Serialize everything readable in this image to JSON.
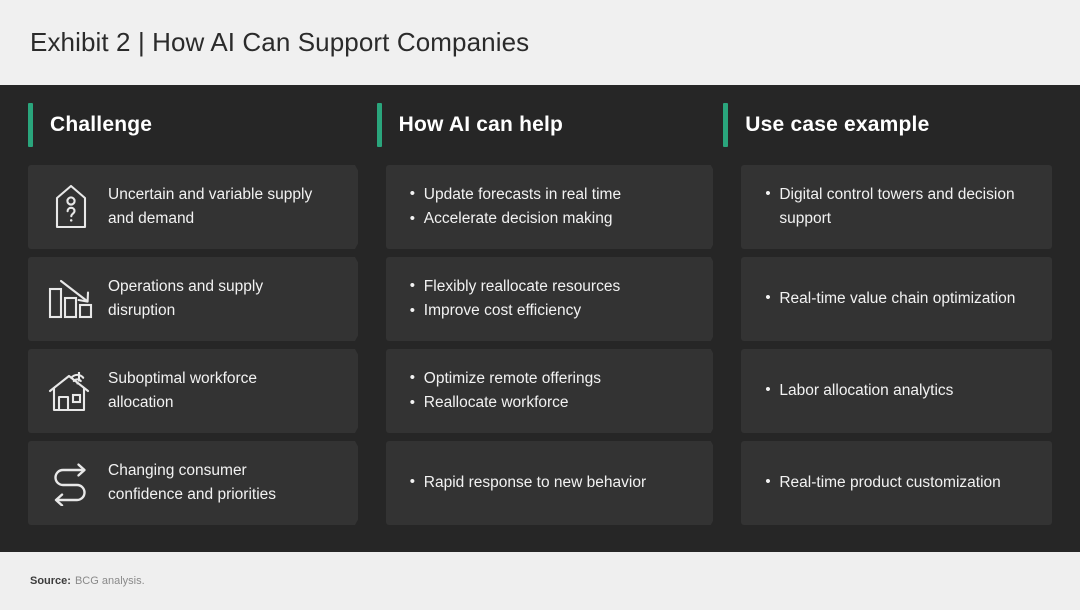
{
  "title": "Exhibit 2 | How AI Can Support Companies",
  "colors": {
    "accent_green": "#2aa57c",
    "dark_bg": "#262626",
    "cell_bg": "#333333",
    "page_bg": "#efefef",
    "text_light": "#f2f2f2"
  },
  "columns": [
    {
      "label": "Challenge"
    },
    {
      "label": "How AI can help"
    },
    {
      "label": "Use case example"
    }
  ],
  "rows": [
    {
      "icon": "tag-question-icon",
      "challenge": "Uncertain and variable supply and demand",
      "help": [
        "Update forecasts in real time",
        "Accelerate decision making"
      ],
      "usecase": [
        "Digital control towers and decision support"
      ]
    },
    {
      "icon": "declining-bar-chart-icon",
      "challenge": "Operations and supply disruption",
      "help": [
        "Flexibly reallocate resources",
        "Improve cost efficiency"
      ],
      "usecase": [
        "Real-time value chain optimization"
      ]
    },
    {
      "icon": "house-wifi-icon",
      "challenge": "Suboptimal workforce allocation",
      "help": [
        "Optimize remote offerings",
        "Reallocate workforce"
      ],
      "usecase": [
        "Labor allocation analytics"
      ]
    },
    {
      "icon": "winding-arrow-icon",
      "challenge": "Changing consumer confidence and priorities",
      "help": [
        "Rapid response to new behavior"
      ],
      "usecase": [
        "Real-time product customization"
      ]
    }
  ],
  "footer": {
    "source_label": "Source:",
    "source_text": "BCG analysis."
  }
}
